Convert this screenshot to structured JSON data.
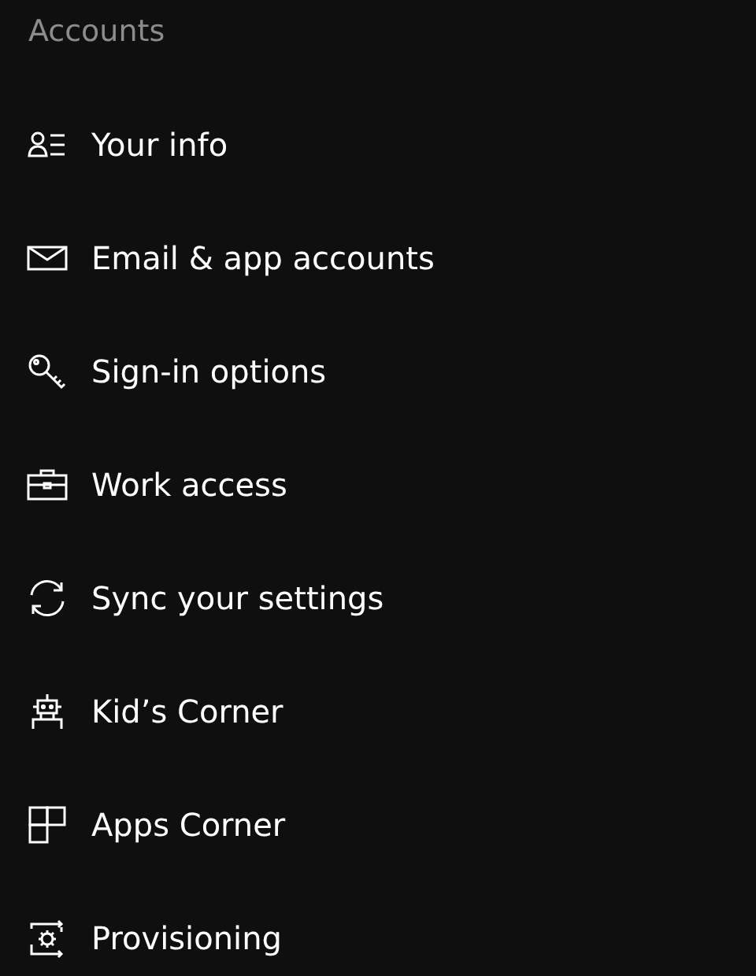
{
  "header": "Accounts",
  "items": [
    {
      "label": "Your info"
    },
    {
      "label": "Email & app accounts"
    },
    {
      "label": "Sign-in options"
    },
    {
      "label": "Work access"
    },
    {
      "label": "Sync your settings"
    },
    {
      "label": "Kid’s Corner"
    },
    {
      "label": "Apps Corner"
    },
    {
      "label": "Provisioning"
    }
  ]
}
